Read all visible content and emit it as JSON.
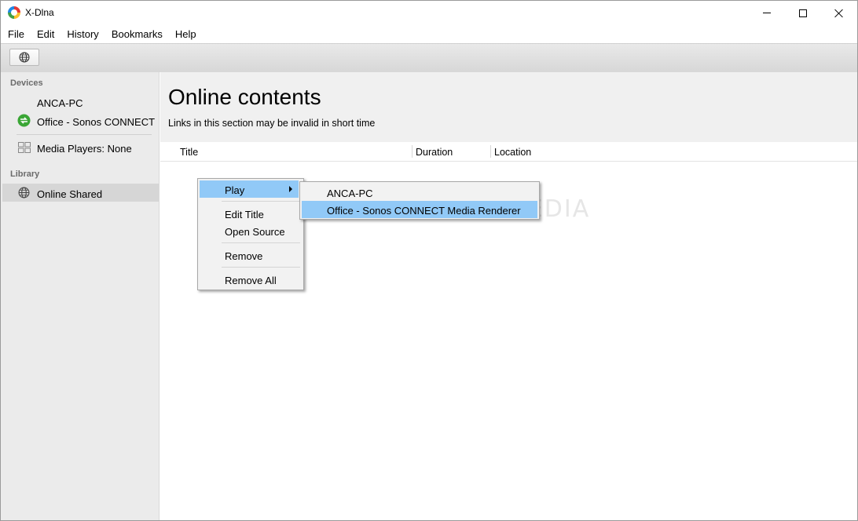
{
  "window": {
    "title": "X-Dlna"
  },
  "menubar": [
    "File",
    "Edit",
    "History",
    "Bookmarks",
    "Help"
  ],
  "toolbar": {
    "buttons": [
      {
        "icon": "globe-icon"
      }
    ]
  },
  "sidebar": {
    "devices_label": "Devices",
    "device_pc": "ANCA-PC",
    "device_sonos": "Office - Sonos CONNECT",
    "media_players": "Media Players: None",
    "library_label": "Library",
    "online_shared": "Online Shared"
  },
  "main": {
    "title": "Online contents",
    "subtitle": "Links in this section may be invalid in short time",
    "columns": [
      "Title",
      "Duration",
      "Location"
    ]
  },
  "context_menu": {
    "items": [
      "Play",
      "Edit Title",
      "Open Source",
      "Remove",
      "Remove All"
    ]
  },
  "submenu": {
    "items": [
      "ANCA-PC",
      "Office - Sonos CONNECT Media Renderer"
    ]
  },
  "watermark": "SOFTPEDIA",
  "colors": {
    "highlight": "#91c9f7",
    "sidebar_bg": "#ebebeb",
    "sonos_icon": "#3aa635"
  }
}
